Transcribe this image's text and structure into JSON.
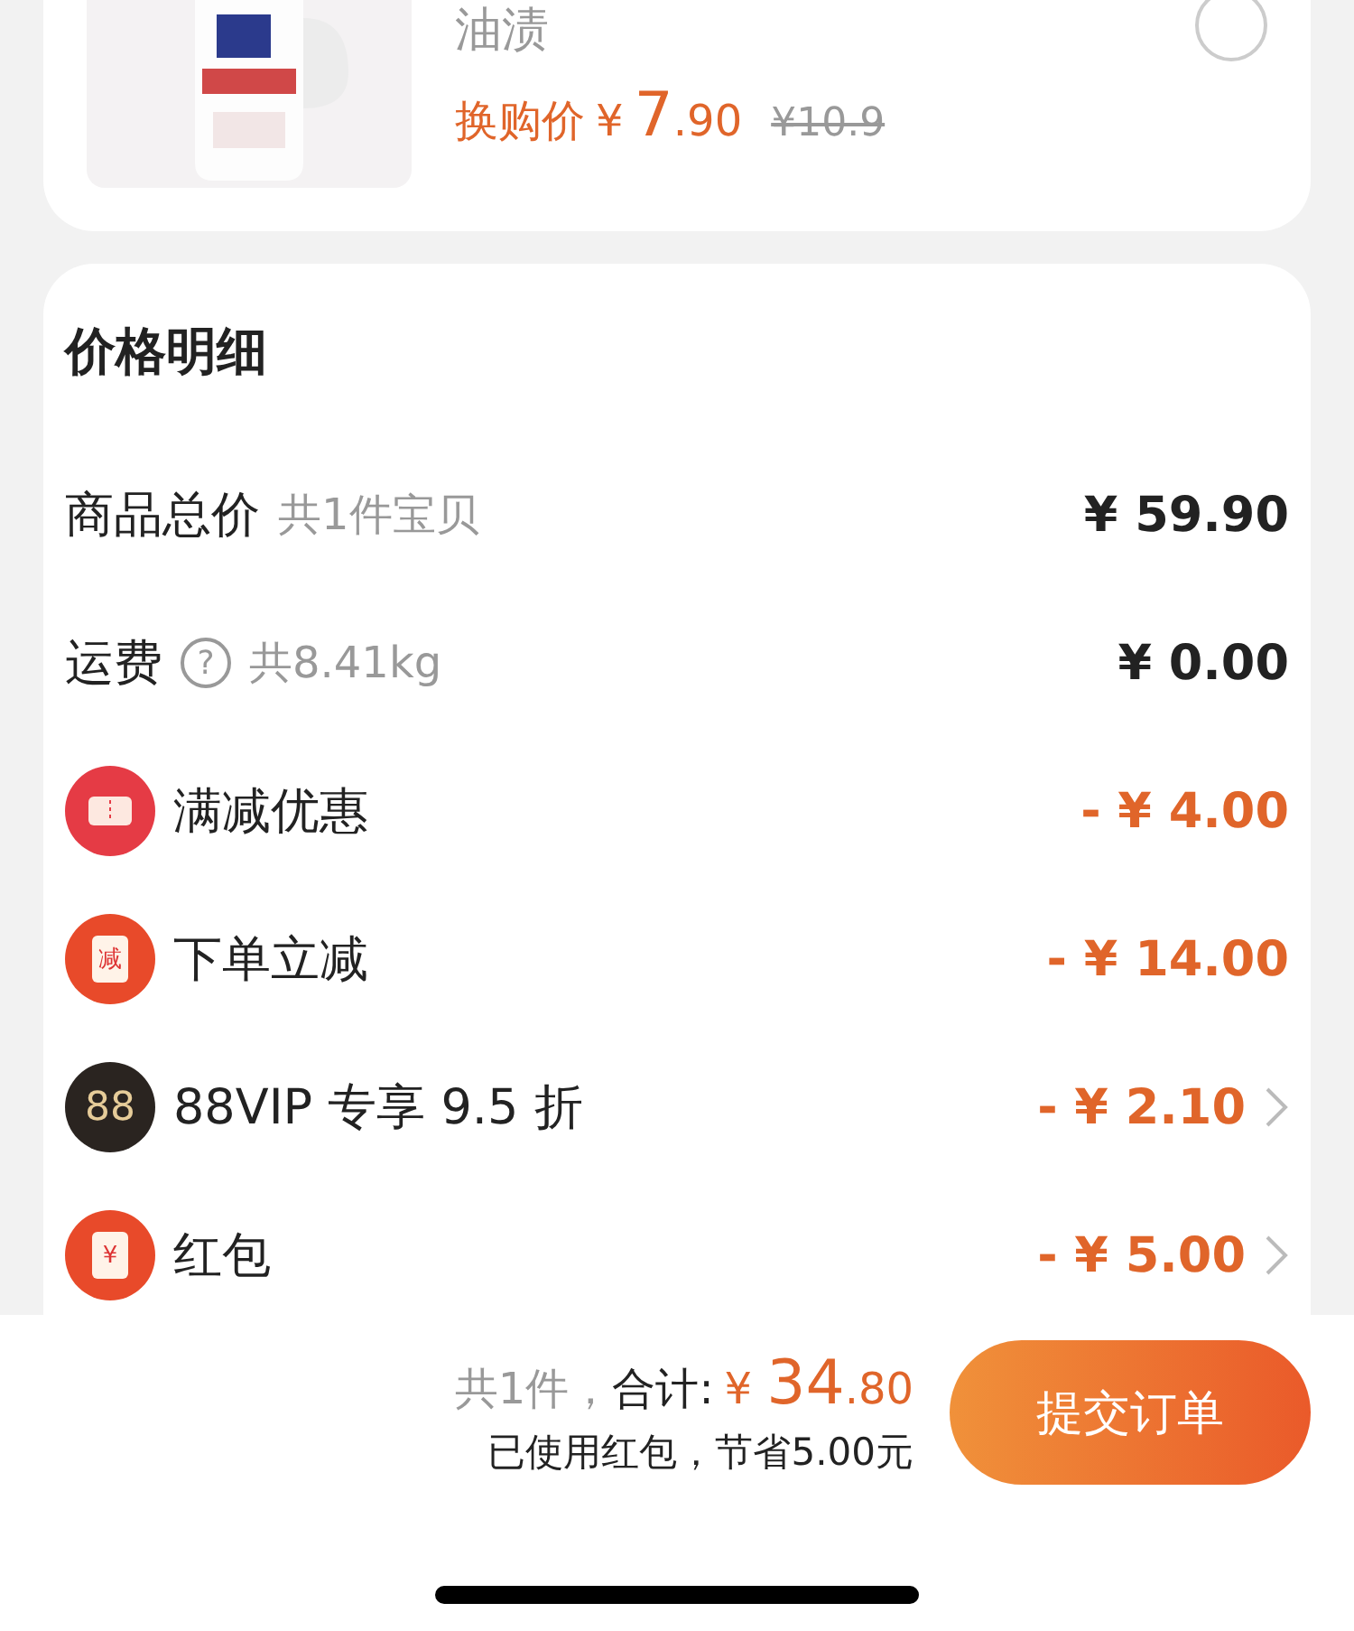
{
  "product": {
    "kind": "picture",
    "title": "油渍",
    "price_label": "换购价",
    "currency": "¥",
    "price_int": "7",
    "price_dec": ".90",
    "original_price": "¥10.9",
    "selected": false
  },
  "price_detail": {
    "title": "价格明细",
    "rows": [
      {
        "kind": "plain",
        "label": "商品总价",
        "note": "共1件宝贝",
        "amount": "¥ 59.90"
      },
      {
        "kind": "plain",
        "label": "运费",
        "help": "?",
        "note": "共8.41kg",
        "amount": "¥ 0.00"
      },
      {
        "kind": "coupon",
        "label": "满减优惠",
        "amount": "- ¥ 4.00",
        "has_arrow": false
      },
      {
        "kind": "stamp",
        "badge": "减",
        "label": "下单立减",
        "amount": "- ¥ 14.00",
        "has_arrow": false
      },
      {
        "kind": "vip",
        "badge": "88",
        "label": "88VIP 专享 9.5 折",
        "amount": "- ¥ 2.10",
        "has_arrow": true
      },
      {
        "kind": "stamp",
        "badge": "¥",
        "label": "红包",
        "amount": "- ¥ 5.00",
        "has_arrow": true
      }
    ]
  },
  "footer": {
    "count": "共1件，",
    "total_label": "合计:",
    "currency": "¥",
    "total_int": "34",
    "total_dec": ".80",
    "savings": "已使用红包，节省5.00元",
    "submit": "提交订单"
  }
}
